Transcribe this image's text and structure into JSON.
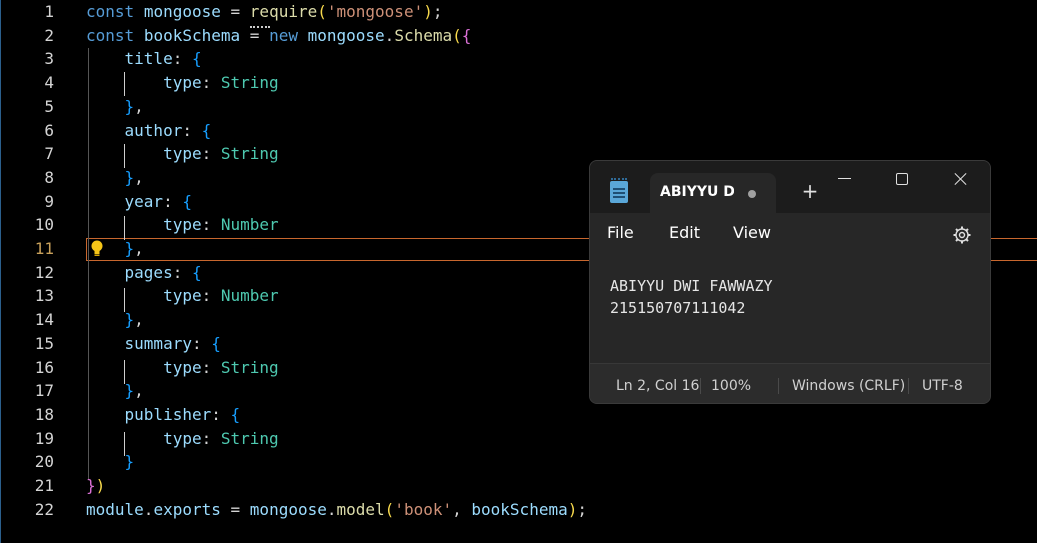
{
  "editor": {
    "current_line": 11,
    "lines": [
      {
        "n": "1",
        "code": "const mongoose = require('mongoose');"
      },
      {
        "n": "2",
        "code": "const bookSchema = new mongoose.Schema({"
      },
      {
        "n": "3",
        "code": "    title: {"
      },
      {
        "n": "4",
        "code": "        type: String"
      },
      {
        "n": "5",
        "code": "    },"
      },
      {
        "n": "6",
        "code": "    author: {"
      },
      {
        "n": "7",
        "code": "        type: String"
      },
      {
        "n": "8",
        "code": "    },"
      },
      {
        "n": "9",
        "code": "    year: {"
      },
      {
        "n": "10",
        "code": "        type: Number"
      },
      {
        "n": "11",
        "code": "    },"
      },
      {
        "n": "12",
        "code": "    pages: {"
      },
      {
        "n": "13",
        "code": "        type: Number"
      },
      {
        "n": "14",
        "code": "    },"
      },
      {
        "n": "15",
        "code": "    summary: {"
      },
      {
        "n": "16",
        "code": "        type: String"
      },
      {
        "n": "17",
        "code": "    },"
      },
      {
        "n": "18",
        "code": "    publisher: {"
      },
      {
        "n": "19",
        "code": "        type: String"
      },
      {
        "n": "20",
        "code": "    }"
      },
      {
        "n": "21",
        "code": "})"
      },
      {
        "n": "22",
        "code": "module.exports = mongoose.model('book', bookSchema);"
      }
    ]
  },
  "notepad": {
    "tab_title": "ABIYYU DWI FAWWAZY",
    "new_tab_symbol": "+",
    "menu": {
      "file": "File",
      "edit": "Edit",
      "view": "View"
    },
    "content": [
      "ABIYYU DWI FAWWAZY",
      "215150707111042"
    ],
    "status": {
      "position": "Ln 2, Col 16",
      "zoom": "100%",
      "line_ending": "Windows (CRLF)",
      "encoding": "UTF-8"
    },
    "icons": {
      "app": "notepad-icon",
      "settings": "gear-icon",
      "minimize": "minimize-icon",
      "maximize": "maximize-icon",
      "close": "close-icon"
    }
  },
  "colors": {
    "keyword": "#569cd6",
    "variable": "#9cdcfe",
    "function": "#dcdcaa",
    "string": "#ce9178",
    "type": "#4ec9b0",
    "current_line_border": "#c8672e",
    "lightbulb": "#f5c518"
  }
}
